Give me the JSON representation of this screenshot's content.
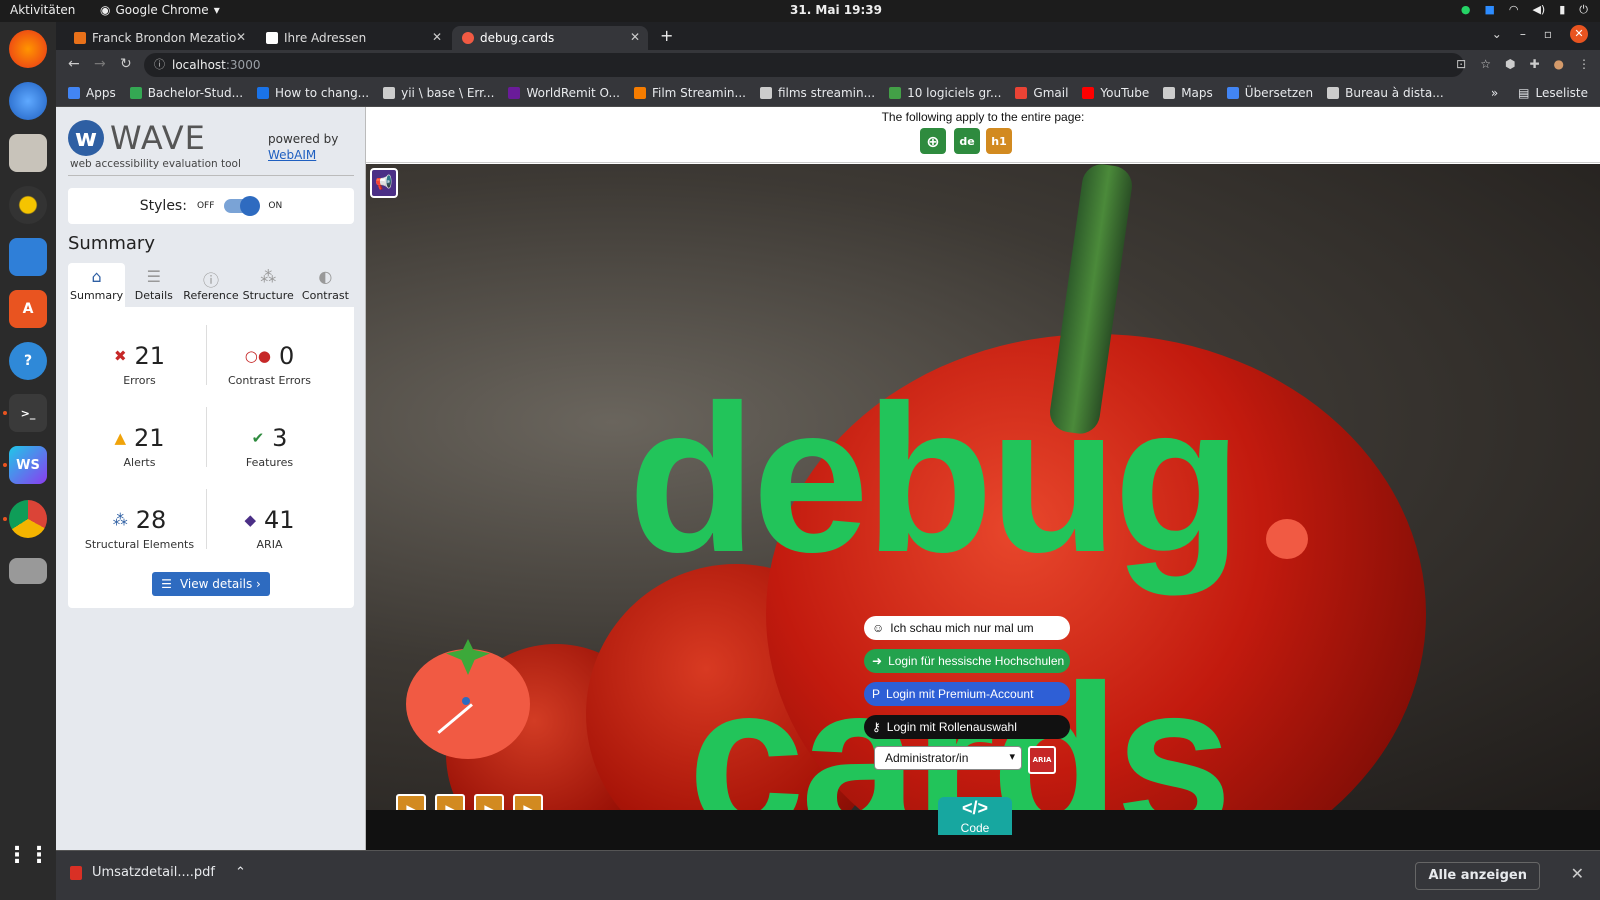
{
  "system": {
    "activities": "Aktivitäten",
    "app_menu": "Google Chrome",
    "clock": "31. Mai  19:39"
  },
  "browser": {
    "tabs": [
      {
        "label": "Franck Brondon Mezatio"
      },
      {
        "label": "Ihre Adressen"
      },
      {
        "label": "debug.cards"
      }
    ],
    "url_host": "localhost",
    "url_port": ":3000",
    "bookmarks": [
      {
        "label": "Apps",
        "color": "#4285f4"
      },
      {
        "label": "Bachelor-Stud...",
        "color": "#34a853"
      },
      {
        "label": "How to chang...",
        "color": "#1a73e8"
      },
      {
        "label": "yii \\ base \\ Err...",
        "color": "#cccccc"
      },
      {
        "label": "WorldRemit O...",
        "color": "#6a1b9a"
      },
      {
        "label": "Film Streamin...",
        "color": "#f57c00"
      },
      {
        "label": "films streamin...",
        "color": "#cccccc"
      },
      {
        "label": "10 logiciels gr...",
        "color": "#43a047"
      },
      {
        "label": "Gmail",
        "color": "#ea4335"
      },
      {
        "label": "YouTube",
        "color": "#ff0000"
      },
      {
        "label": "Maps",
        "color": "#cccccc"
      },
      {
        "label": "Übersetzen",
        "color": "#4285f4"
      },
      {
        "label": "Bureau à dista...",
        "color": "#cccccc"
      }
    ],
    "reading_list": "Leseliste",
    "overflow": "»"
  },
  "wave": {
    "logo_text": "WAVE",
    "tagline": "web accessibility evaluation tool",
    "powered_by": "powered by",
    "webaim_link": "WebAIM",
    "styles_label": "Styles:",
    "styles_off": "OFF",
    "styles_on": "ON",
    "summary_heading": "Summary",
    "tabs": [
      {
        "label": "Summary",
        "icon": "home-icon"
      },
      {
        "label": "Details",
        "icon": "list-icon"
      },
      {
        "label": "Reference",
        "icon": "info-icon"
      },
      {
        "label": "Structure",
        "icon": "structure-icon"
      },
      {
        "label": "Contrast",
        "icon": "contrast-icon"
      }
    ],
    "stats": {
      "errors": {
        "value": "21",
        "label": "Errors",
        "color": "#c62828"
      },
      "contrast_errors": {
        "value": "0",
        "label": "Contrast Errors",
        "color": "#c62828"
      },
      "alerts": {
        "value": "21",
        "label": "Alerts",
        "color": "#f0a30a"
      },
      "features": {
        "value": "3",
        "label": "Features",
        "color": "#2e8b3e"
      },
      "structural": {
        "value": "28",
        "label": "Structural Elements",
        "color": "#2e5fa3"
      },
      "aria": {
        "value": "41",
        "label": "ARIA",
        "color": "#4b2f86"
      }
    },
    "view_details": "View details ›"
  },
  "page": {
    "note": "The following apply to the entire page:",
    "lang_badge": "de",
    "heading_badge": "h1",
    "title_top": "debug",
    "title_bottom": "cards",
    "buttons": {
      "guest": "Ich schau mich nur mal um",
      "hessen": "Login für hessische Hochschulen",
      "premium": "Login mit Premium-Account",
      "role": "Login mit Rollenauswahl"
    },
    "role_select": "Administrator/in",
    "aria_flag": "ARIA",
    "code_label": "Code",
    "code_symbol": "</>"
  },
  "downloads": {
    "file": "Umsatzdetail....pdf",
    "show_all": "Alle anzeigen"
  }
}
